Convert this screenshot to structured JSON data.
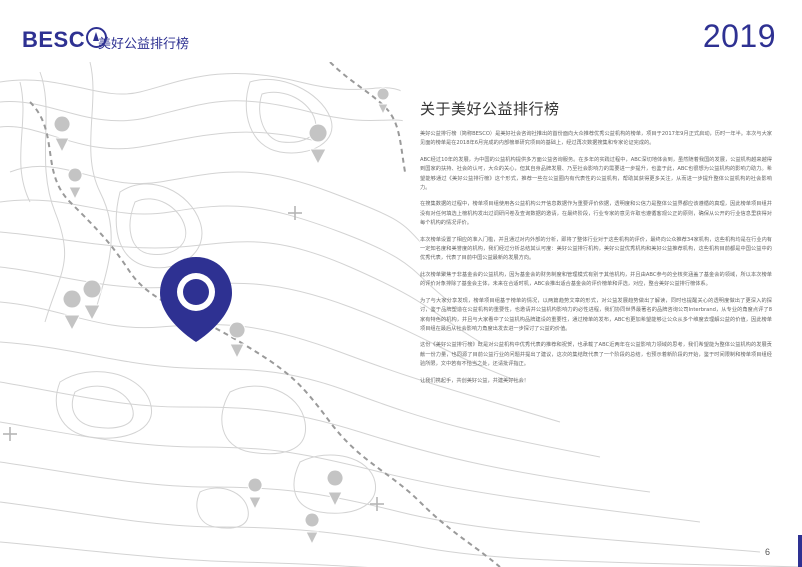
{
  "header": {
    "logo_text": "BESC",
    "brand_subtitle": "美好公益排行榜",
    "year": "2019"
  },
  "main": {
    "title": "关于美好公益排行榜",
    "paragraphs": [
      "美好公益排行榜（简称BESCO）是美好社会咨询社推出的首份面向大众推荐优秀公益机构的榜单，项目于2017年9月正式启动，历时一年半。本次与大家见面的榜单是在2018年6月完成的内部榜单研究项目的基础上，经过再次数据搜集和专家论证完成的。",
      "ABC经过10年的发展，为中国的公益机构提供多方面公益咨询服务。在多年的实践过程中，ABC深切地体会到，虽然随着我国的发展，公益机构越来越得到国家的扶持、社会的认可，大众的关心，但其自身品牌发展、乃至社会影响力的需要进一步提升，也鉴于此，ABC也很想为公益机构的影响力助力。希望能够通过《美好公益排行榜》这个形式，推荐一些在公益圈内有代表性的公益机构，帮助其获得更多关注，从而进一步提升整体公益机构的社会影响力。",
      "在搜集数据的过程中，榜单项目组使用各公益机构公开信息数据作为重要评价依据，透明度和公信力是整体公益界都应该遵循的真理，因此榜单项目组并没有对任何填选上榜机构发出过调研问卷及查询数据的邀请，在最终阶段，行业专家的意见许取也遵循客观公正的原则，确保从公开的行业信息里获得对每个机构的情况评价。",
      "本次榜单设置了相应的准入门槛，并且通过对内外部的分析，即将了整体行业对于这些机构的评价，最终向公众推荐34家机构，这些机构均是在行业内有一定知名度和美誉度的机构，我们经过分析总结其认可度：美好公益排行机构，美好公益优秀机构和美好公益推荐机构，这些机构目前都是中国公益中的优秀代表，代表了目前中国公益最新的发展方向。",
      "此次榜单聚焦于非基金会的公益机构，因为基金会的财务制度和管理模式有别于其他机构，并且由ABC参与的全核奖涵盖了基金会的领域，所以本次榜单的评价对象排除了基金会主体，未来在合适时机，ABC会推出适合基金会的评价榜单和评选，对应，整合美好公益排行榜体系。",
      "为了与大家分享发现，榜单项目组基于榜单的情况，以两篇趋势文章的形式，对公益发展趋势做出了解读，同时也提醒关心的透明度做出了更深入的探讨，鉴于品牌塑造在公益机构的重要性，也邀请并公益机构影响力的必性进程，我们协同世界最著名的品牌咨询公司Interbrand，从专业的角度点评了8家有特色的机构，并且与大家看中了公益机构品牌建设的重要性，通过榜单的发布，ABC也更加希望能够让公众从多个维度去理解公益的价值，因此榜单项目组在最后从社会影响力角度出发去进一步探讨了公益的价值。",
      "这份《美好公益排行榜》既是对公益机构中优秀代表的推荐和祝贺，也承载了ABC近两年在公益影响力领域的思考，我们希望能为整体公益机构的发展贡献一份力量，也同源了目前公益行业的问题并提出了建议，这次的集结既代表了一个阶段的总结，也预示着新阶段的开始，鉴于时间限制和榜单项目组经验所限，文中若有不恰当之处，还请批评指正。",
      "让我们携起手，共创美好公益，共建美好社会！"
    ]
  },
  "footer": {
    "page_number": "6"
  },
  "colors": {
    "brand": "#2e3192",
    "pin_gray": "#bcbcbc",
    "contour": "#cfcfcf"
  }
}
